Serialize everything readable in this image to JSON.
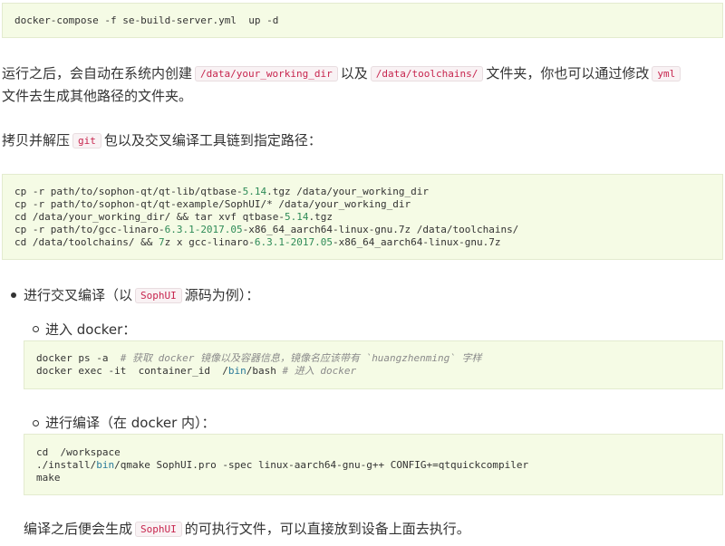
{
  "code_block_1": {
    "lines": [
      [
        {
          "t": "docker-compose -f se-build-server.yml  up -d"
        }
      ]
    ]
  },
  "para_1": {
    "text_a": "运行之后，会自动在系统内创建",
    "code_a": "/data/your_working_dir",
    "text_b": "以及",
    "code_b": "/data/toolchains/",
    "text_c": "文件夹，你也可以通过修改",
    "code_c": "yml",
    "line2": "文件去生成其他路径的文件夹。"
  },
  "para_2": {
    "text_a": "拷贝并解压",
    "code_a": "git",
    "text_b": "包以及交叉编译工具链到指定路径："
  },
  "code_block_2": {
    "lines": [
      [
        {
          "t": "cp -r path/to/sophon-qt/qt-lib/qtbase-"
        },
        {
          "t": "5.14",
          "c": "num"
        },
        {
          "t": ".tgz /data/your_working_dir"
        }
      ],
      [
        {
          "t": "cp -r path/to/sophon-qt/qt-example/SophUI/* /data/your_working_dir"
        }
      ],
      [
        {
          "t": "cd /data/your_working_dir/ && tar xvf qtbase-"
        },
        {
          "t": "5.14",
          "c": "num"
        },
        {
          "t": ".tgz"
        }
      ],
      [
        {
          "t": "cp -r path/to/gcc-linaro-"
        },
        {
          "t": "6.3.1-2017.05",
          "c": "num"
        },
        {
          "t": "-x86_64_aarch64-linux-gnu.7z /data/toolchains/"
        }
      ],
      [
        {
          "t": "cd /data/toolchains/ && "
        },
        {
          "t": "7",
          "c": "num"
        },
        {
          "t": "z x gcc-linaro-"
        },
        {
          "t": "6.3.1-2017.05",
          "c": "num"
        },
        {
          "t": "-x86_64_aarch64-linux-gnu.7z"
        }
      ]
    ]
  },
  "bullet_1": {
    "text_a": "进行交叉编译（以",
    "code_a": "SophUI",
    "text_b": "源码为例）："
  },
  "sub_1": {
    "text": "进入 docker："
  },
  "code_block_3": {
    "lines": [
      [
        {
          "t": "docker ps -a  "
        },
        {
          "t": "# 获取 docker 镜像以及容器信息，镜像名应该带有 `huangzhenming` 字样",
          "c": "cmt"
        }
      ],
      [
        {
          "t": "docker exec -it  container_id  /"
        },
        {
          "t": "bin",
          "c": "kw"
        },
        {
          "t": "/bash "
        },
        {
          "t": "# 进入 docker",
          "c": "cmt"
        }
      ]
    ]
  },
  "sub_2": {
    "text": "进行编译（在 docker 内）："
  },
  "code_block_4": {
    "lines": [
      [
        {
          "t": "cd  /workspace"
        }
      ],
      [
        {
          "t": "./install/"
        },
        {
          "t": "bin",
          "c": "kw"
        },
        {
          "t": "/qmake SophUI.pro -spec linux-aarch64-gnu-g++ CONFIG+=qtquickcompiler"
        }
      ],
      [
        {
          "t": "make"
        }
      ]
    ]
  },
  "para_3": {
    "text_a": "编译之后便会生成",
    "code_a": "SophUI",
    "text_b": "的可执行文件，可以直接放到设备上面去执行。"
  }
}
